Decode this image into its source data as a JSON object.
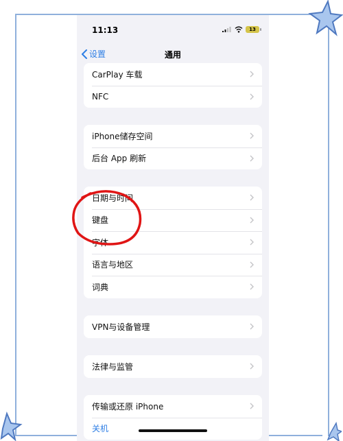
{
  "status_bar": {
    "time": "11:13",
    "battery": "13",
    "battery_color": "#d4c44a"
  },
  "nav": {
    "back_label": "设置",
    "title": "通用",
    "accent_color": "#2d7ee5"
  },
  "groups": [
    {
      "items": [
        {
          "label": "CarPlay 车载"
        },
        {
          "label": "NFC"
        }
      ]
    },
    {
      "items": [
        {
          "label": "iPhone储存空间"
        },
        {
          "label": "后台 App 刷新"
        }
      ]
    },
    {
      "items": [
        {
          "label": "日期与时间"
        },
        {
          "label": "键盘"
        },
        {
          "label": "字体"
        },
        {
          "label": "语言与地区"
        },
        {
          "label": "词典"
        }
      ]
    },
    {
      "items": [
        {
          "label": "VPN与设备管理"
        }
      ]
    },
    {
      "items": [
        {
          "label": "法律与监管"
        }
      ]
    },
    {
      "items": [
        {
          "label": "传输或还原 iPhone"
        },
        {
          "label": "关机"
        }
      ]
    }
  ],
  "icons": {
    "row_chevron": "chevron-right-icon",
    "back": "chevron-left-icon",
    "annotation_color": "#e01515"
  }
}
